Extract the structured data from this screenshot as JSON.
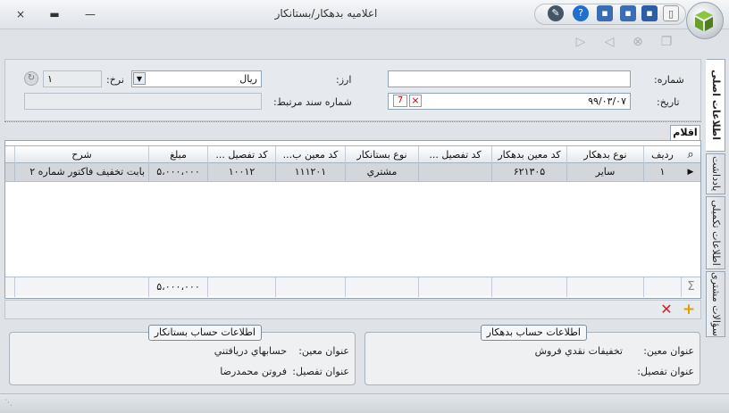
{
  "window": {
    "title": "اعلامیه بدهکار/بستانکار",
    "close": "×",
    "maximize": "▬",
    "minimize": "—"
  },
  "form": {
    "number_label": "شماره:",
    "number_value": "",
    "date_label": "تاریخ:",
    "date_value": "۹۹/۰۳/۰۷",
    "currency_label": "ارز:",
    "currency_value": "ریال",
    "rate_label": "نرخ:",
    "rate_value": "۱",
    "related_doc_label": "شماره سند مرتبط:",
    "related_doc_value": ""
  },
  "tabs": {
    "main": "اطلاعات اصلی",
    "notes": "یادداشت",
    "extra": "اطلاعات تکمیلی",
    "questions": "سؤالات مشتری"
  },
  "items": {
    "tab_label": "اقلام",
    "columns": [
      "ردیف",
      "نوع بدهکار",
      "کد معین بدهکار",
      "کد تفصیل ...",
      "نوع بستانکار",
      "کد معین ب...",
      "کد تفصیل ...",
      "مبلغ",
      "شرح"
    ],
    "rows": [
      [
        "۱",
        "سایر",
        "۶۲۱۳۰۵",
        "",
        "مشتري",
        "۱۱۱۲۰۱",
        "۱۰۰۱۲",
        "۵،۰۰۰،۰۰۰",
        "بابت تخفیف فاکتور شماره ۲"
      ]
    ],
    "total_amount": "۵،۰۰۰،۰۰۰",
    "sum_symbol": "Σ"
  },
  "debtor_box": {
    "title": "اطلاعات حساب بدهکار",
    "moein_label": "عنوان معین:",
    "moein_value": "تخفیفات نقدي فروش",
    "tafsil_label": "عنوان تفصیل:",
    "tafsil_value": ""
  },
  "creditor_box": {
    "title": "اطلاعات حساب بستانکار",
    "moein_label": "عنوان معین:",
    "moein_value": "حسابهاي دريافتني",
    "tafsil_label": "عنوان تفصیل:",
    "tafsil_value": "فروتن محمدرضا"
  }
}
